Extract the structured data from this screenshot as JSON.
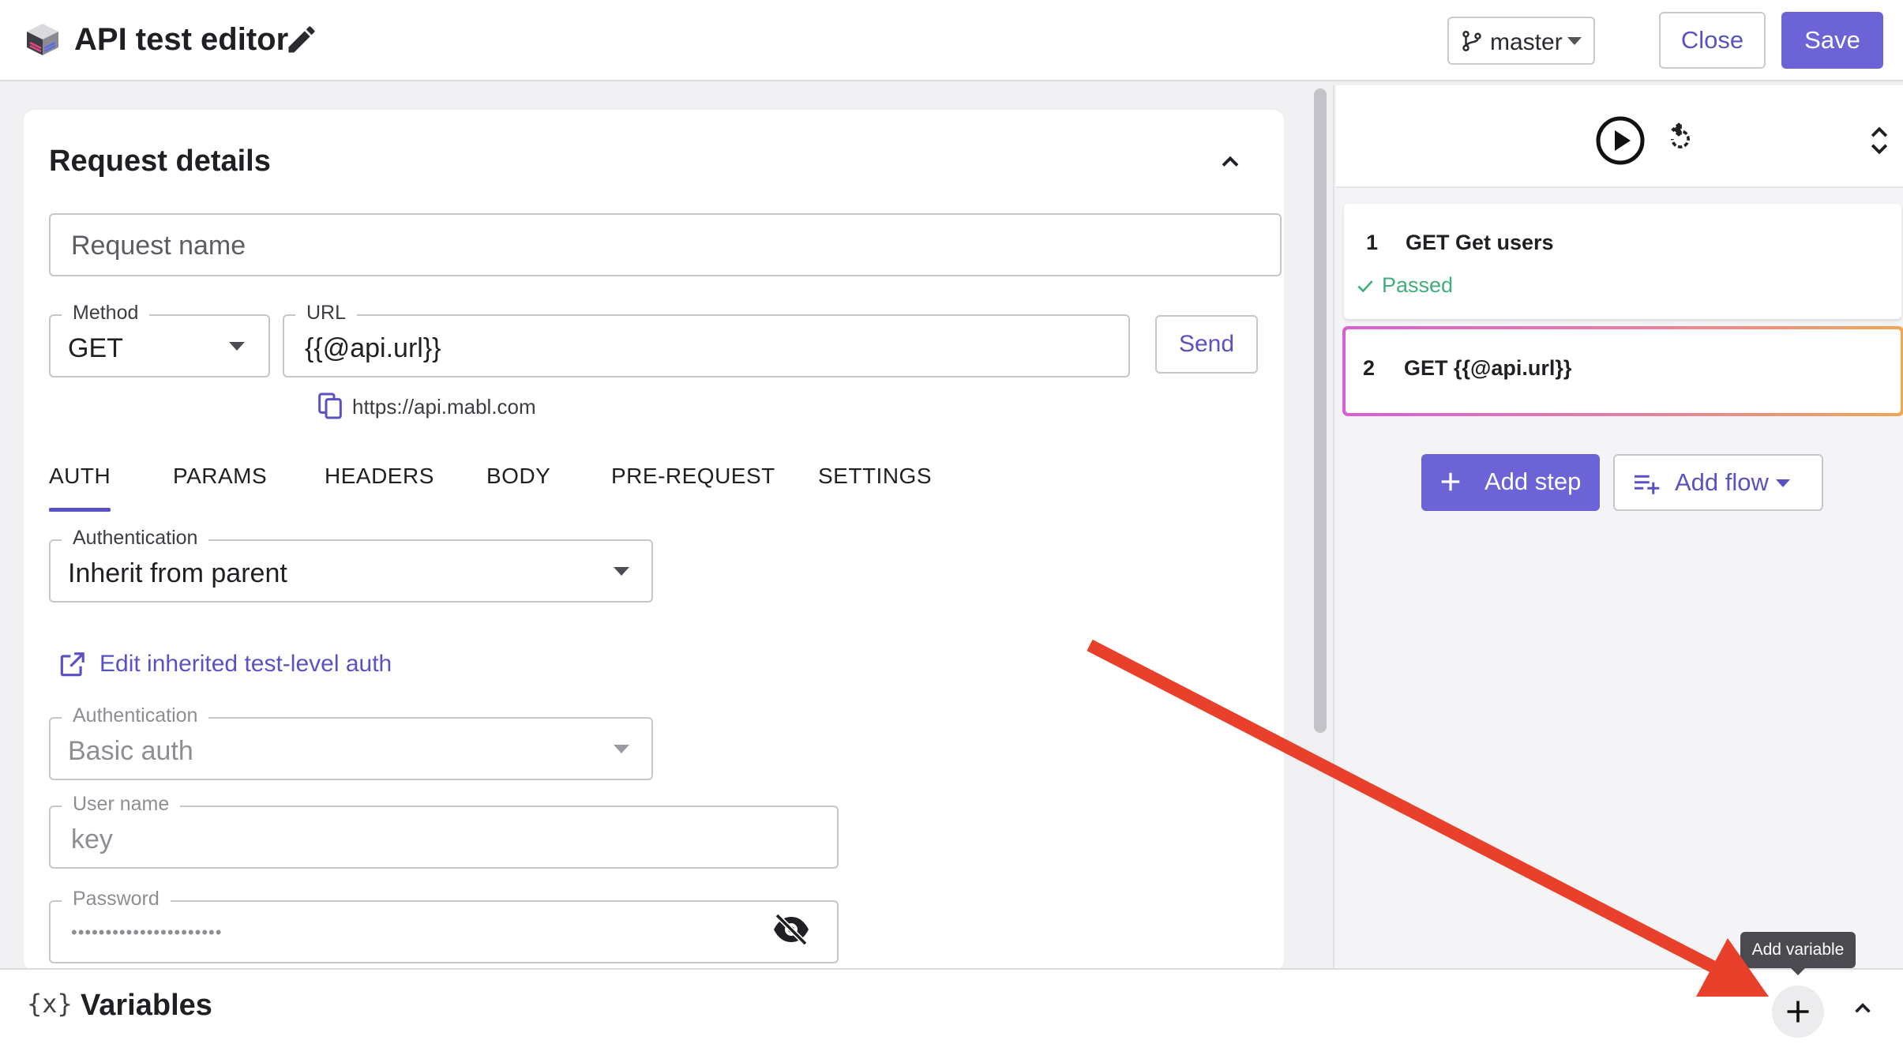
{
  "header": {
    "title": "API test editor",
    "branch": "master",
    "close_label": "Close",
    "save_label": "Save"
  },
  "request_details": {
    "title": "Request details",
    "name_placeholder": "Request name",
    "method": {
      "label": "Method",
      "value": "GET"
    },
    "url": {
      "label": "URL",
      "value": "{{@api.url}}"
    },
    "send_label": "Send",
    "resolved_url": "https://api.mabl.com",
    "tabs": [
      "AUTH",
      "PARAMS",
      "HEADERS",
      "BODY",
      "PRE-REQUEST",
      "SETTINGS"
    ],
    "active_tab": "AUTH",
    "auth": {
      "label": "Authentication",
      "value": "Inherit from parent"
    },
    "edit_link": "Edit inherited test-level auth",
    "inherited_auth": {
      "label": "Authentication",
      "value": "Basic auth"
    },
    "username": {
      "label": "User name",
      "value": "key"
    },
    "password": {
      "label": "Password",
      "value": "••••••••••••••••••••••"
    }
  },
  "steps": [
    {
      "number": "1",
      "title": "GET Get users",
      "status": "Passed"
    },
    {
      "number": "2",
      "title": "GET {{@api.url}}"
    }
  ],
  "actions": {
    "add_step": "Add step",
    "add_flow": "Add flow"
  },
  "variables": {
    "icon": "{x}",
    "title": "Variables",
    "add_tooltip": "Add variable"
  },
  "colors": {
    "accent": "#6b63d6",
    "passed": "#3fae7c",
    "annotation_arrow": "#e8402a"
  },
  "icons": [
    "mabl-logo",
    "pencil-icon",
    "branch-icon",
    "chevron-up-icon",
    "copy-icon",
    "external-link-icon",
    "eye-off-icon",
    "play-icon",
    "replay-icon",
    "expand-icon",
    "check-icon",
    "plus-icon",
    "playlist-add-icon"
  ]
}
